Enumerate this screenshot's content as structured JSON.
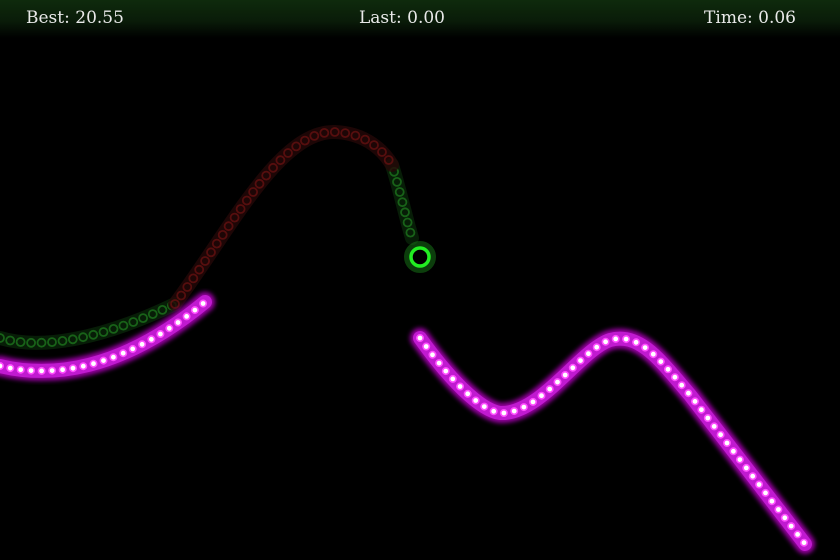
{
  "hud": {
    "best_label": "Best:",
    "best_value": "20.55",
    "last_label": "Last:",
    "last_value": "0.00",
    "time_label": "Time:",
    "time_value": "0.06"
  },
  "colors": {
    "background": "#000000",
    "hud_background": "#0e2a0c",
    "hud_text": "#e9e9e9",
    "wall_glow": "#b400c0",
    "wall_bead_ring": "#ff4dff",
    "wall_bead_core": "#ffffff",
    "trail_green": "#1f7a1f",
    "trail_red": "#6a1212",
    "player_ring": "#22ee22"
  },
  "icons": {
    "player": "player-ring-icon"
  }
}
